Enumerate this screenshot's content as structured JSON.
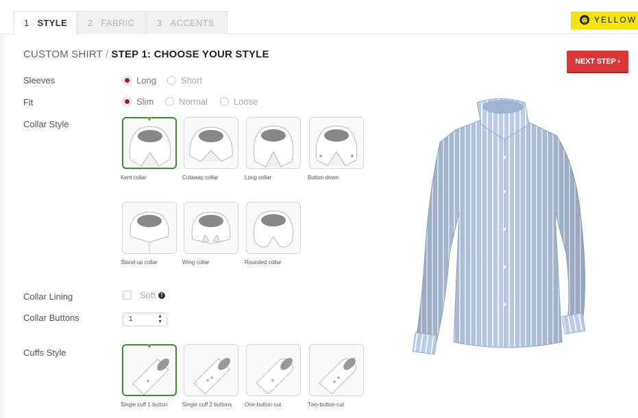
{
  "tabs": [
    {
      "num": "1",
      "label": "STYLE",
      "active": true
    },
    {
      "num": "2",
      "label": "FABRIC",
      "active": false
    },
    {
      "num": "3",
      "label": "ACCENTS",
      "active": false
    }
  ],
  "brand": {
    "name": "YELLOW",
    "color": "#f5e40a"
  },
  "title": {
    "prefix": "CUSTOM SHIRT",
    "separator": "/",
    "step": "STEP 1: CHOOSE YOUR STYLE"
  },
  "next_button": {
    "label": "NEXT STEP ›",
    "color": "#d9383a"
  },
  "sleeves": {
    "label": "Sleeves",
    "options": [
      "Long",
      "Short"
    ],
    "selected": "Long"
  },
  "fit": {
    "label": "Fit",
    "options": [
      "Slim",
      "Normal",
      "Loose"
    ],
    "selected": "Slim"
  },
  "collar_style": {
    "label": "Collar Style",
    "selected": "Kent collar",
    "options": [
      "Kent collar",
      "Cutaway collar",
      "Long collar",
      "Button-down",
      "Stand-up collar",
      "Wing collar",
      "Rounded collar"
    ]
  },
  "collar_lining": {
    "label": "Collar Lining",
    "option": "Soft",
    "checked": false
  },
  "collar_buttons": {
    "label": "Collar Buttons",
    "value": "1"
  },
  "cuffs_style": {
    "label": "Cuffs Style",
    "selected": "Single cuff 1 button",
    "options": [
      "Single cuff 1 button",
      "Single cuff 2 buttons",
      "One-button-cut",
      "Two-button-cut"
    ]
  },
  "colors": {
    "accent_red": "#b3161a",
    "selected_green": "#3a8f2a",
    "shirt_blue": "#b9cdea"
  }
}
